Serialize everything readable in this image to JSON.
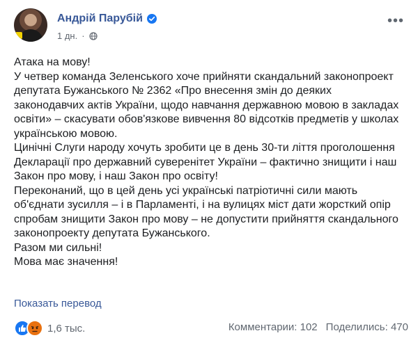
{
  "post": {
    "author_name": "Андрій Парубій",
    "timestamp": "1 дн.",
    "separator": "·",
    "paragraphs": [
      "Атака на мову!",
      "У четвер команда Зеленського хоче прийняти скандальний законопроект депутата Бужанського № 2362 «Про внесення змін до деяких законодавчих актів України, щодо навчання державною мовою в закладах освіти» – скасувати обов'язкове вивчення 80 відсотків предметів у школах українською мовою.",
      "Цинічні Слуги народу хочуть зробити це в день 30-ти ліття проголошення Декларації про державний суверенітет України – фактично знищити і наш Закон про мову, і наш Закон про освіту!",
      "Переконаний, що в цей день усі українські патріотичні сили мають об'єднати зусилля – і в Парламенті, і на вулицях міст дати жорсткий опір спробам знищити Закон про мову – не допустити прийняття скандального законопроекту депутата Бужанського.",
      "Разом ми сильні!",
      "Мова має значення!"
    ],
    "translate_label": "Показать перевод",
    "reactions_count": "1,6 тыс.",
    "comments_label": "Комментарии: 102",
    "shares_label": "Поделились: 470"
  },
  "icons": {
    "verified": "verified-badge-icon",
    "privacy": "globe-icon",
    "more": "more-options-icon",
    "reactions": [
      "like-icon",
      "angry-icon"
    ]
  },
  "colors": {
    "author": "#385898",
    "link": "#385898",
    "verified": "#1877f2",
    "like": "#1877f2",
    "angry": "#e9710f",
    "meta": "#616770"
  }
}
